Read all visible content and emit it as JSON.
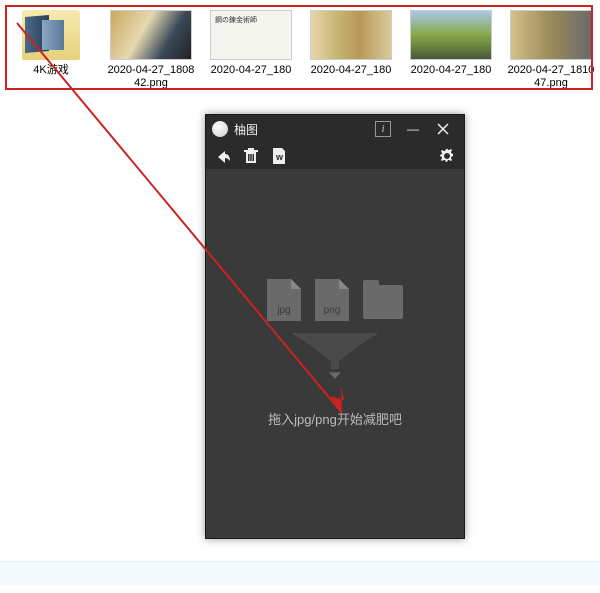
{
  "files": [
    {
      "label": "4K游戏",
      "type": "folder"
    },
    {
      "label": "2020-04-27_180842.png",
      "type": "anime"
    },
    {
      "label": "2020-04-27_180",
      "type": "white"
    },
    {
      "label": "2020-04-27_180",
      "type": "group"
    },
    {
      "label": "2020-04-27_180",
      "type": "field"
    },
    {
      "label": "2020-04-27_181047.png",
      "type": "pair"
    }
  ],
  "app": {
    "title": "柚图",
    "drop_hint": "拖入jpg/png开始减肥吧",
    "format_jpg": "jpg",
    "format_png": "png"
  },
  "icons": {
    "info": "i",
    "minimize": "—"
  }
}
